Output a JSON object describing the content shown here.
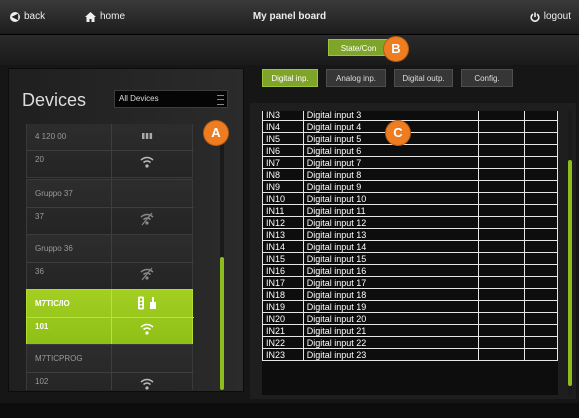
{
  "topbar": {
    "back": "back",
    "home": "home",
    "title": "My panel board",
    "logout": "logout"
  },
  "state_button": "State/Con",
  "badges": {
    "a": "A",
    "b": "B",
    "c": "C"
  },
  "devices_panel": {
    "title": "Devices",
    "filter": "All Devices"
  },
  "devices": [
    {
      "name": "4 120 00",
      "id": "20",
      "type_icon": "grid-icon",
      "signal_icon": "wifi-icon"
    },
    {
      "name": "Gruppo 37",
      "id": "37",
      "type_icon": "",
      "signal_icon": "wifi-off-icon"
    },
    {
      "name": "Gruppo 36",
      "id": "36",
      "type_icon": "",
      "signal_icon": "wifi-off-icon"
    },
    {
      "name": "M7TIC/IO",
      "id": "101",
      "type_icon": "traffic-light-hand-icon",
      "signal_icon": "wifi-icon",
      "selected": true
    },
    {
      "name": "M7TICPROG",
      "id": "102",
      "type_icon": "",
      "signal_icon": "wifi-icon"
    }
  ],
  "tabs": [
    {
      "label": "Digital inp.",
      "active": true
    },
    {
      "label": "Analog inp.",
      "active": false
    },
    {
      "label": "Digital outp.",
      "active": false
    },
    {
      "label": "Config.",
      "active": false
    }
  ],
  "inputs": [
    {
      "code": "IN3",
      "label": "Digital input 3"
    },
    {
      "code": "IN4",
      "label": "Digital input 4"
    },
    {
      "code": "IN5",
      "label": "Digital input 5"
    },
    {
      "code": "IN6",
      "label": "Digital input 6"
    },
    {
      "code": "IN7",
      "label": "Digital input 7"
    },
    {
      "code": "IN8",
      "label": "Digital input 8"
    },
    {
      "code": "IN9",
      "label": "Digital input 9"
    },
    {
      "code": "IN10",
      "label": "Digital input 10"
    },
    {
      "code": "IN11",
      "label": "Digital input 11"
    },
    {
      "code": "IN12",
      "label": "Digital input 12"
    },
    {
      "code": "IN13",
      "label": "Digital input 13"
    },
    {
      "code": "IN14",
      "label": "Digital input 14"
    },
    {
      "code": "IN15",
      "label": "Digital input 15"
    },
    {
      "code": "IN16",
      "label": "Digital input 16"
    },
    {
      "code": "IN17",
      "label": "Digital input 17"
    },
    {
      "code": "IN18",
      "label": "Digital input 18"
    },
    {
      "code": "IN19",
      "label": "Digital input 19"
    },
    {
      "code": "IN20",
      "label": "Digital input 20"
    },
    {
      "code": "IN21",
      "label": "Digital input 21"
    },
    {
      "code": "IN22",
      "label": "Digital input 22"
    },
    {
      "code": "IN23",
      "label": "Digital input 23"
    }
  ],
  "colors": {
    "accent": "#8cbd1d",
    "badge": "#ee7d21",
    "background": "#161616"
  }
}
